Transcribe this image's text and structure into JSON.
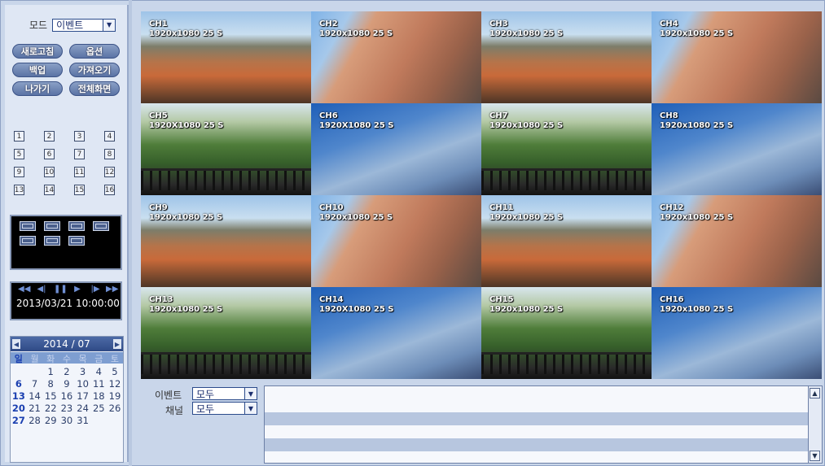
{
  "sidebar": {
    "mode_label": "모드",
    "mode_value": "이벤트",
    "buttons": [
      "새로고침",
      "옵션",
      "백업",
      "가져오기",
      "나가기",
      "전체화면"
    ],
    "channel_buttons": [
      "1",
      "2",
      "3",
      "4",
      "5",
      "6",
      "7",
      "8",
      "9",
      "10",
      "11",
      "12",
      "13",
      "14",
      "15",
      "16"
    ],
    "layout_icons": [
      "layout-1-icon",
      "layout-4-icon",
      "layout-6-icon",
      "layout-8-icon",
      "layout-9-icon",
      "layout-13-icon",
      "layout-16-icon"
    ],
    "playback_controls": [
      "rewind-fast-icon",
      "step-back-icon",
      "pause-icon",
      "play-icon",
      "step-forward-icon",
      "fast-forward-icon"
    ],
    "datetime": "2013/03/21  10:00:00"
  },
  "calendar": {
    "month_label": "2014 / 07",
    "weekdays": [
      "일",
      "월",
      "화",
      "수",
      "목",
      "금",
      "토"
    ],
    "weeks": [
      [
        "",
        "",
        "1",
        "2",
        "3",
        "4",
        "5"
      ],
      [
        "6",
        "7",
        "8",
        "9",
        "10",
        "11",
        "12"
      ],
      [
        "13",
        "14",
        "15",
        "16",
        "17",
        "18",
        "19"
      ],
      [
        "20",
        "21",
        "22",
        "23",
        "24",
        "25",
        "26"
      ],
      [
        "27",
        "28",
        "29",
        "30",
        "31",
        "",
        ""
      ]
    ]
  },
  "channels": [
    {
      "name": "CH1",
      "res": "1920x1080 25 S",
      "scene": "city"
    },
    {
      "name": "CH2",
      "res": "1920x1080 25 S",
      "scene": "arch"
    },
    {
      "name": "CH3",
      "res": "1920x1080 25 S",
      "scene": "city"
    },
    {
      "name": "CH4",
      "res": "1920x1080 25 S",
      "scene": "arch"
    },
    {
      "name": "CH5",
      "res": "1920X1080 25 S",
      "scene": "tree"
    },
    {
      "name": "CH6",
      "res": "1920X1080 25 S",
      "scene": "sky"
    },
    {
      "name": "CH7",
      "res": "1920x1080 25 S",
      "scene": "tree"
    },
    {
      "name": "CH8",
      "res": "1920x1080 25 S",
      "scene": "sky"
    },
    {
      "name": "CH9",
      "res": "1920x1080 25 S",
      "scene": "city"
    },
    {
      "name": "CH10",
      "res": "1920x1080 25 S",
      "scene": "arch"
    },
    {
      "name": "CH11",
      "res": "1920x1080 25 S",
      "scene": "city"
    },
    {
      "name": "CH12",
      "res": "1920x1080 25 S",
      "scene": "arch"
    },
    {
      "name": "CH13",
      "res": "1920x1080 25 S",
      "scene": "tree"
    },
    {
      "name": "CH14",
      "res": "1920X1080 25 S",
      "scene": "sky"
    },
    {
      "name": "CH15",
      "res": "1920x1080 25 S",
      "scene": "tree"
    },
    {
      "name": "CH16",
      "res": "1920x1080 25 S",
      "scene": "sky"
    }
  ],
  "filters": {
    "event_label": "이벤트",
    "event_value": "모두",
    "channel_label": "채널",
    "channel_value": "모두"
  }
}
